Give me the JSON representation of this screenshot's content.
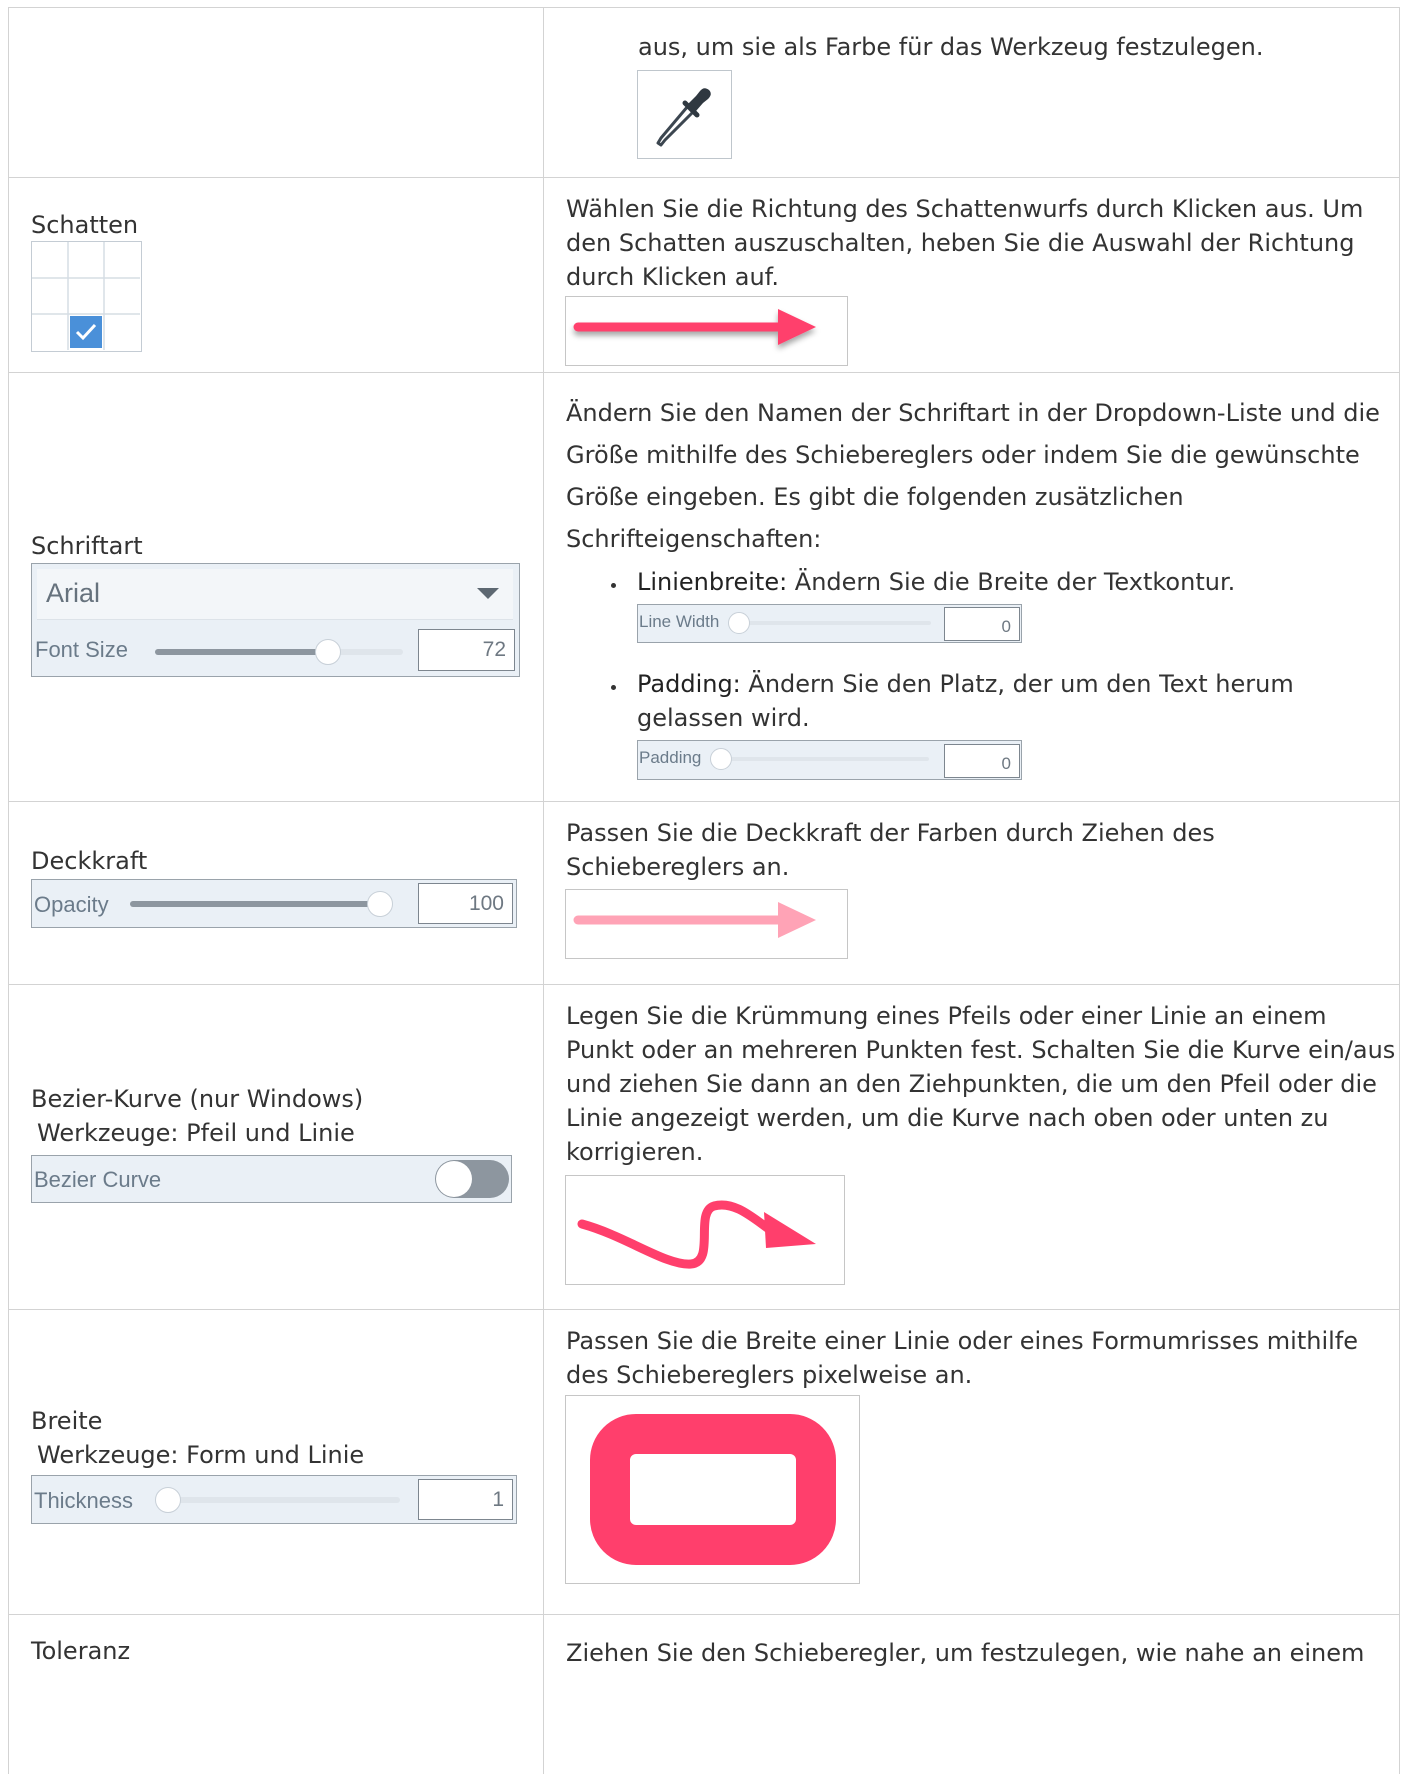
{
  "rows": {
    "color_tool": {
      "description": "aus, um sie als Farbe für das Werkzeug festzulegen.",
      "icon": "eyedropper-icon"
    },
    "shadow": {
      "label": "Schatten",
      "description": [
        "Wählen Sie die Richtung des Schattenwurfs durch Klicken aus. Um",
        "den Schatten auszuschalten, heben Sie die Auswahl der Richtung",
        "durch Klicken auf."
      ],
      "icon": "checkmark-icon"
    },
    "font": {
      "label": "Schriftart",
      "font_name": "Arial",
      "font_size_label": "Font Size",
      "font_size_value": "72",
      "font_size_fraction": 0.69,
      "description": [
        "Ändern Sie den Namen der Schriftart in der Dropdown-Liste und die",
        "Größe mithilfe des Schiebereglers oder indem Sie die gewünschte",
        "Größe eingeben. Es gibt die folgenden zusätzlichen",
        "Schrifteigenschaften:"
      ],
      "bullets": [
        {
          "term": "Linienbreite:",
          "text": " Ändern Sie die Breite der Textkontur.",
          "slider_label": "Line Width",
          "slider_value": "0"
        },
        {
          "term": "Padding:",
          "text": " Ändern Sie den Platz, der um den Text herum",
          "text2": "gelassen wird.",
          "slider_label": "Padding",
          "slider_value": "0"
        }
      ]
    },
    "opacity": {
      "label": "Deckkraft",
      "slider_label": "Opacity",
      "slider_value": "100",
      "slider_fraction": 1.0,
      "description": [
        "Passen Sie die Deckkraft der Farben durch Ziehen des",
        "Schiebereglers an."
      ]
    },
    "bezier": {
      "label": "Bezier-Kurve (nur Windows)",
      "tools": "Werkzeuge: Pfeil und Linie",
      "toggle_label": "Bezier Curve",
      "toggle_state": "off",
      "description": [
        "Legen Sie die Krümmung eines Pfeils oder einer Linie an einem",
        "Punkt oder an mehreren Punkten fest. Schalten Sie die Kurve ein/aus",
        "und ziehen Sie dann an den Ziehpunkten, die um den Pfeil oder die",
        "Linie angezeigt werden, um die Kurve nach oben oder unten zu",
        "korrigieren."
      ]
    },
    "thickness": {
      "label": "Breite",
      "tools": "Werkzeuge: Form und Linie",
      "slider_label": "Thickness",
      "slider_value": "1",
      "slider_fraction": 0.0,
      "description": [
        "Passen Sie die Breite einer Linie oder eines Formumrisses mithilfe",
        "des Schiebereglers pixelweise an."
      ]
    },
    "tolerance": {
      "label": "Toleranz",
      "description": "Ziehen Sie den Schieberegler, um festzulegen, wie nahe an einem"
    }
  },
  "colors": {
    "accent_pink": "#ff3f6c",
    "accent_pink_light": "#ffa3b6",
    "checkbox_blue": "#4a90d9",
    "panel_bg": "#eaf0f6",
    "border": "#d3d3d3"
  }
}
